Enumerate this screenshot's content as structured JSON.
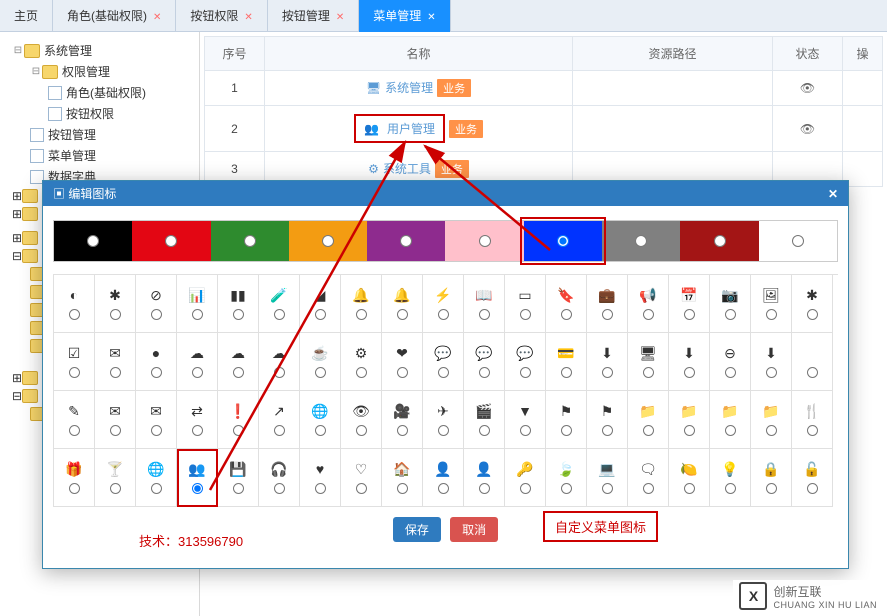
{
  "tabs": [
    {
      "label": "主页",
      "closable": false
    },
    {
      "label": "角色(基础权限)",
      "closable": true
    },
    {
      "label": "按钮权限",
      "closable": true
    },
    {
      "label": "按钮管理",
      "closable": true
    },
    {
      "label": "菜单管理",
      "closable": true,
      "active": true
    }
  ],
  "tree": [
    {
      "level": 1,
      "label": "系统管理",
      "type": "folder",
      "toggle": "⊟"
    },
    {
      "level": 2,
      "label": "权限管理",
      "type": "folder",
      "toggle": "⊟"
    },
    {
      "level": 3,
      "label": "角色(基础权限)",
      "type": "file"
    },
    {
      "level": 3,
      "label": "按钮权限",
      "type": "file"
    },
    {
      "level": 2,
      "label": "按钮管理",
      "type": "file"
    },
    {
      "level": 2,
      "label": "菜单管理",
      "type": "file"
    },
    {
      "level": 2,
      "label": "数据字典",
      "type": "file"
    }
  ],
  "table": {
    "headers": [
      "序号",
      "名称",
      "资源路径",
      "状态",
      "操"
    ],
    "rows": [
      {
        "idx": "1",
        "icon": "🖥",
        "name": "系统管理",
        "badge": "业务"
      },
      {
        "idx": "2",
        "icon": "👥",
        "name": "用户管理",
        "badge": "业务",
        "highlight": true
      },
      {
        "idx": "3",
        "icon": "⚙",
        "name": "系统工具",
        "badge": "业务"
      }
    ]
  },
  "modal": {
    "title": "编辑图标",
    "colors": [
      {
        "hex": "#000000"
      },
      {
        "hex": "#e30613"
      },
      {
        "hex": "#2e8b2e"
      },
      {
        "hex": "#f39c12"
      },
      {
        "hex": "#8e2b8e"
      },
      {
        "hex": "#ffc0cb"
      },
      {
        "hex": "#0033ff",
        "selected": true
      },
      {
        "hex": "#808080"
      },
      {
        "hex": "#a31515"
      },
      {
        "hex": "#ffffff"
      }
    ],
    "iconRows": [
      [
        "◐",
        "✱",
        "⊘",
        "📊",
        "▮▮",
        "🧪",
        "◢",
        "🔔",
        "🔔",
        "⚡",
        "📖",
        "▭",
        "🔖",
        "💼",
        "📢",
        "📅",
        "📷",
        "🖼",
        "✱"
      ],
      [
        "☑",
        "✉",
        "●",
        "☁",
        "☁",
        "☁",
        "☕",
        "⚙",
        "❤",
        "💬",
        "💬",
        "💬",
        "💳",
        "⬇",
        "🖥",
        "⬇",
        "⊖",
        "⬇",
        " "
      ],
      [
        "✎",
        "✉",
        "✉",
        "⇄",
        "❗",
        "↗",
        "🌐",
        "👁",
        "🎥",
        "✈",
        "🎬",
        "▼",
        "⚑",
        "⚑",
        "📁",
        "📁",
        "📁",
        "📁",
        "🍴"
      ],
      [
        "🎁",
        "🍸",
        "🌐",
        "👥",
        "💾",
        "🎧",
        "♥",
        "♡",
        "🏠",
        "👤",
        "👤",
        "🔑",
        "🍃",
        "💻",
        "🗨",
        "🍋",
        "💡",
        "🔒",
        "🔓"
      ]
    ],
    "selectedIcon": {
      "row": 3,
      "col": 3
    },
    "save": "保存",
    "cancel": "取消",
    "customLabel": "自定义菜单图标",
    "tech": "技术：313596790"
  },
  "watermark": {
    "main": "创新互联",
    "sub": "CHUANG XIN HU LIAN"
  }
}
